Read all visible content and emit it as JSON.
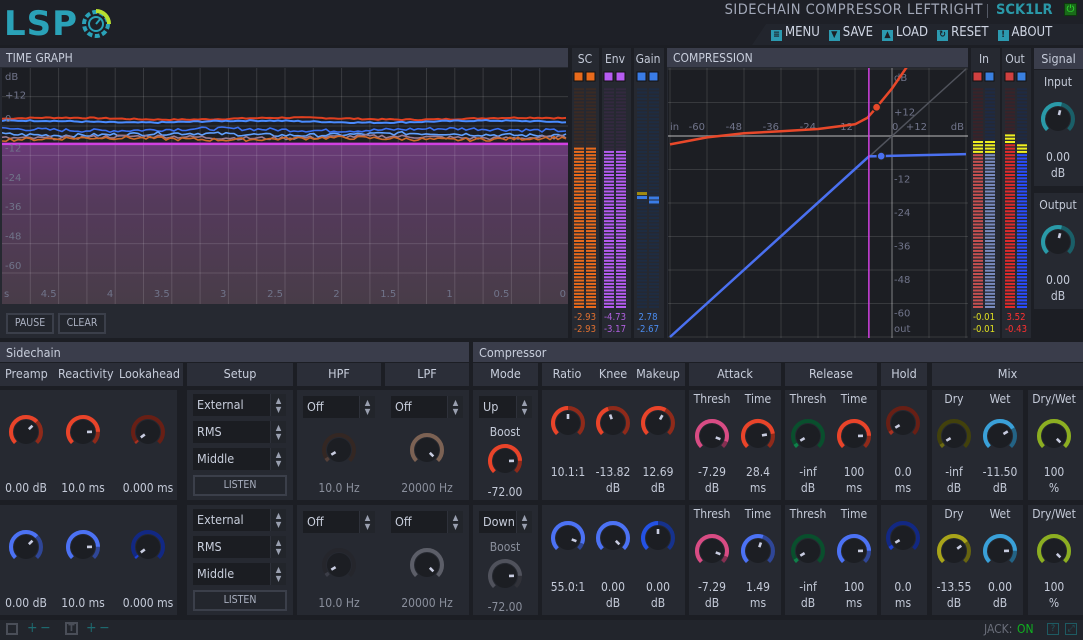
{
  "header": {
    "logo": "LSP",
    "title": "SIDECHAIN COMPRESSOR LEFTRIGHT",
    "code": "SCK1LR",
    "power_icon": "power-icon",
    "menu": [
      {
        "label": "MENU",
        "icon": "menu-icon"
      },
      {
        "label": "SAVE",
        "icon": "save-icon"
      },
      {
        "label": "LOAD",
        "icon": "load-icon"
      },
      {
        "label": "RESET",
        "icon": "reset-icon"
      },
      {
        "label": "ABOUT",
        "icon": "about-icon"
      }
    ]
  },
  "time_graph": {
    "title": "TIME GRAPH",
    "y_unit": "dB",
    "y_ticks": [
      "+12",
      "0",
      "-12",
      "-24",
      "-36",
      "-48",
      "-60"
    ],
    "x_unit": "s",
    "x_ticks": [
      "4.5",
      "4",
      "3.5",
      "3",
      "2.5",
      "2",
      "1.5",
      "1",
      "0.5",
      "0"
    ],
    "threshold_db": -7.29,
    "series": [
      {
        "color": "#e04020",
        "level_db": 3
      },
      {
        "color": "#4a8cff",
        "level_db": 1.8
      },
      {
        "color": "#3a70f0",
        "level_db": -1.5
      },
      {
        "color": "#60a0ff",
        "level_db": -3.4
      },
      {
        "color": "#9a7a90",
        "level_db": -4.6
      },
      {
        "color": "#d06828",
        "level_db": -5.2
      }
    ],
    "pause": "PAUSE",
    "clear": "CLEAR"
  },
  "meters": {
    "sc": {
      "label": "SC",
      "color": "#e86a1c",
      "dim": "#3a2a24",
      "levels": [
        0.73,
        0.73
      ],
      "values": [
        "-2.93",
        "-2.93"
      ],
      "value_color": "#e07030"
    },
    "env": {
      "label": "Env",
      "color": "#b65cf2",
      "dim": "#33293f",
      "levels": [
        0.71,
        0.71
      ],
      "values": [
        "-4.73",
        "-3.17"
      ],
      "value_color": "#b060e0"
    },
    "gain": {
      "label": "Gain",
      "color": "#3a7ce6",
      "dim": "#1e2c42",
      "levels": [
        0.52,
        0.5
      ],
      "values": [
        "2.78",
        "-2.67"
      ],
      "value_color": "#4a8cf0"
    },
    "in": {
      "label": "In",
      "colors": [
        "#c85050",
        "#7a8cc0"
      ],
      "dim": "#3a2228",
      "levels": [
        0.75,
        0.75
      ],
      "values": [
        "-0.01",
        "-0.01"
      ],
      "value_color": "#e0e020"
    },
    "out": {
      "label": "Out",
      "colors": [
        "#e02a2a",
        "#2a4cff"
      ],
      "dim": "#3a2228",
      "levels": [
        0.79,
        0.74
      ],
      "values": [
        "3.52",
        "-0.43"
      ],
      "value_color": "#ff3030"
    }
  },
  "compression": {
    "title": "COMPRESSION",
    "in_label": "in",
    "out_label": "out",
    "unit": "dB",
    "x_ticks": [
      "-60",
      "-48",
      "-36",
      "-24",
      "-12",
      "0",
      "+12"
    ],
    "y_ticks": [
      "+12",
      "-12",
      "-24",
      "-36",
      "-48",
      "-60"
    ],
    "threshold_db": -7.5,
    "gain_curve": [
      [
        -72,
        -3
      ],
      [
        -60,
        -0.5
      ],
      [
        -48,
        1
      ],
      [
        -36,
        1.7
      ],
      [
        -24,
        2.5
      ],
      [
        -12,
        4.2
      ],
      [
        -8,
        6.5
      ],
      [
        -6,
        9
      ],
      [
        -3,
        13
      ],
      [
        0,
        17
      ],
      [
        5,
        25
      ],
      [
        12,
        32
      ]
    ],
    "transfer_curve": [
      [
        -72,
        -72
      ],
      [
        -7.5,
        -7.3
      ],
      [
        24,
        -6.5
      ]
    ],
    "gain_point": [
      -5,
      10.3
    ],
    "out_point": [
      -3.5,
      -7.2
    ]
  },
  "signal": {
    "title": "Signal",
    "input": {
      "label": "Input",
      "value": "0.00",
      "unit": "dB",
      "color": "#2a9aa8",
      "level": 0.55
    },
    "output": {
      "label": "Output",
      "value": "0.00",
      "unit": "dB",
      "color": "#2a9aa8",
      "level": 0.55
    }
  },
  "sidechain": {
    "title": "Sidechain",
    "headers": {
      "preamp": "Preamp",
      "reactivity": "Reactivity",
      "lookahead": "Lookahead",
      "setup": "Setup",
      "hpf": "HPF",
      "lpf": "LPF"
    },
    "rows": [
      {
        "preamp": {
          "value": "0.00 dB",
          "color": "#e8442a",
          "level": 0.67
        },
        "reactivity": {
          "value": "10.0 ms",
          "color": "#e8442a",
          "level": 0.83
        },
        "lookahead": {
          "value": "0.000 ms",
          "color": "#a83222",
          "level": 0.03
        },
        "source": "External",
        "mode": "RMS",
        "split": "Middle",
        "listen": "LISTEN",
        "hpf": {
          "mode": "Off",
          "value": "10.0 Hz",
          "color": "#54403a",
          "level": 0.05
        },
        "lpf": {
          "mode": "Off",
          "value": "20000 Hz",
          "color": "#7c6254",
          "level": 1
        }
      },
      {
        "preamp": {
          "value": "0.00 dB",
          "color": "#4c72f4",
          "level": 0.67
        },
        "reactivity": {
          "value": "10.0 ms",
          "color": "#4c72f4",
          "level": 0.83
        },
        "lookahead": {
          "value": "0.000 ms",
          "color": "#1e42d4",
          "level": 0.03
        },
        "source": "External",
        "mode": "RMS",
        "split": "Middle",
        "listen": "LISTEN",
        "hpf": {
          "mode": "Off",
          "value": "10.0 Hz",
          "color": "#3c3e48",
          "level": 0.05
        },
        "lpf": {
          "mode": "Off",
          "value": "20000 Hz",
          "color": "#5c5e68",
          "level": 1
        }
      }
    ]
  },
  "compressor": {
    "title": "Compressor",
    "headers": {
      "mode": "Mode",
      "ratio": "Ratio",
      "knee": "Knee",
      "makeup": "Makeup",
      "attack": "Attack",
      "release": "Release",
      "hold": "Hold",
      "mix": "Mix"
    },
    "sub": {
      "thresh": "Thresh",
      "time": "Time",
      "dry": "Dry",
      "wet": "Wet",
      "drywet": "Dry/Wet",
      "boost": "Boost"
    },
    "rows": [
      {
        "mode": "Up",
        "boost": {
          "value": "-72.00",
          "color": "#e8442a",
          "level": 0.83
        },
        "ratio": {
          "value": "10.1:1",
          "color": "#e8442a",
          "level": 0.5
        },
        "knee": {
          "value": "-13.82",
          "unit": "dB",
          "color": "#e8442a",
          "level": 0.43
        },
        "makeup": {
          "value": "12.69",
          "unit": "dB",
          "color": "#e8442a",
          "level": 0.61
        },
        "attack_thresh": {
          "value": "-7.29",
          "unit": "dB",
          "color": "#d84c84",
          "level": 0.91
        },
        "attack_time": {
          "value": "28.4",
          "unit": "ms",
          "color": "#e8442a",
          "level": 0.8
        },
        "release_thresh": {
          "value": "-inf",
          "unit": "dB",
          "color": "#10804a",
          "level": 0.05
        },
        "release_time": {
          "value": "100",
          "unit": "ms",
          "color": "#e8442a",
          "level": 0.83
        },
        "hold": {
          "value": "0.0",
          "unit": "ms",
          "color": "#a83222",
          "level": 0.05
        },
        "dry": {
          "value": "-inf",
          "unit": "dB",
          "color": "#6c6a14",
          "level": 0.05
        },
        "wet": {
          "value": "-11.50",
          "unit": "dB",
          "color": "#3aa0d8",
          "level": 0.72
        },
        "drywet": {
          "value": "100",
          "unit": "%",
          "color": "#8cae22",
          "level": 1
        }
      },
      {
        "mode": "Down",
        "boost": {
          "value": "-72.00",
          "color": "#50525c",
          "level": 0.83
        },
        "ratio": {
          "value": "55.0:1",
          "color": "#4c72f4",
          "level": 0.91
        },
        "knee": {
          "value": "0.00",
          "unit": "dB",
          "color": "#4c72f4",
          "level": 1
        },
        "makeup": {
          "value": "0.00",
          "unit": "dB",
          "color": "#2452e4",
          "level": 0.5
        },
        "attack_thresh": {
          "value": "-7.29",
          "unit": "dB",
          "color": "#d84c84",
          "level": 0.91
        },
        "attack_time": {
          "value": "1.49",
          "unit": "ms",
          "color": "#4c72f4",
          "level": 0.57
        },
        "release_thresh": {
          "value": "-inf",
          "unit": "dB",
          "color": "#10804a",
          "level": 0.05
        },
        "release_time": {
          "value": "100",
          "unit": "ms",
          "color": "#4c72f4",
          "level": 0.83
        },
        "hold": {
          "value": "0.0",
          "unit": "ms",
          "color": "#1e42d4",
          "level": 0.05
        },
        "dry": {
          "value": "-13.55",
          "unit": "dB",
          "color": "#a8a41a",
          "level": 0.7
        },
        "wet": {
          "value": "0.00",
          "unit": "dB",
          "color": "#3aa0d8",
          "level": 0.83
        },
        "drywet": {
          "value": "100",
          "unit": "%",
          "color": "#8cae22",
          "level": 1
        }
      }
    ]
  },
  "footer": {
    "jack_label": "JACK:",
    "jack_status": "ON",
    "jack_color": "#10b020"
  }
}
